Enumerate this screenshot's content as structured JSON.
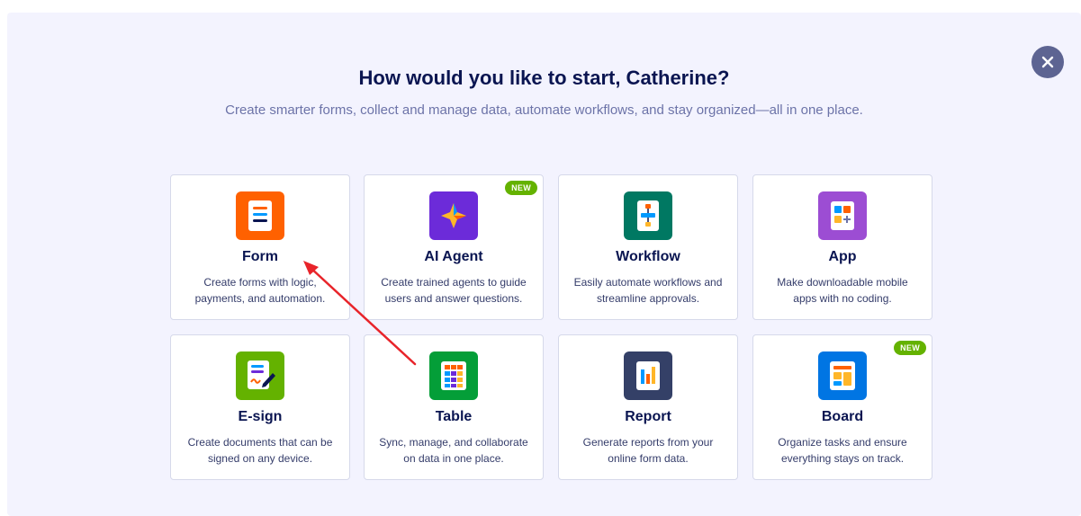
{
  "header": {
    "title": "How would you like to start, Catherine?",
    "subtitle": "Create smarter forms, collect and manage data, automate workflows, and stay organized—all in one place."
  },
  "close_icon": "close-icon",
  "cards": [
    {
      "name": "Form",
      "desc1": "Create forms with logic,",
      "desc2": "payments, and automation.",
      "icon": "form-icon",
      "color": "#ff6100"
    },
    {
      "name": "AI Agent",
      "desc1": "Create trained agents to guide",
      "desc2": "users and answer questions.",
      "icon": "ai-agent-icon",
      "color": "#6c2bd9",
      "badge": "NEW"
    },
    {
      "name": "Workflow",
      "desc1": "Easily automate workflows and",
      "desc2": "streamline approvals.",
      "icon": "workflow-icon",
      "color": "#007862"
    },
    {
      "name": "App",
      "desc1": "Make downloadable mobile",
      "desc2": "apps with no coding.",
      "icon": "app-icon",
      "color": "#9c4dd3"
    },
    {
      "name": "E-sign",
      "desc1": "Create documents that can be",
      "desc2": "signed on any device.",
      "icon": "esign-icon",
      "color": "#64b200"
    },
    {
      "name": "Table",
      "desc1": "Sync, manage, and collaborate",
      "desc2": "on data in one place.",
      "icon": "table-icon",
      "color": "#049e38"
    },
    {
      "name": "Report",
      "desc1": "Generate reports from your",
      "desc2": "online form data.",
      "icon": "report-icon",
      "color": "#344067"
    },
    {
      "name": "Board",
      "desc1": "Organize tasks and ensure",
      "desc2": "everything stays on track.",
      "icon": "board-icon",
      "color": "#0075e3",
      "badge": "NEW"
    }
  ],
  "annotation": {
    "color": "#e8242a"
  }
}
